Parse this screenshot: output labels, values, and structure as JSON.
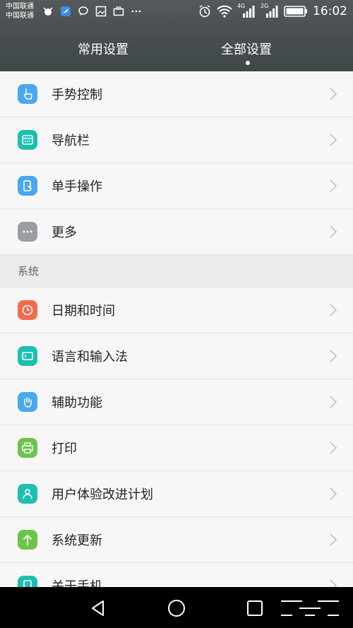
{
  "status_bar": {
    "carrier_1": "中国联通",
    "carrier_2": "中国联通",
    "network_1": "4G",
    "network_2": "2G",
    "time": "16:02"
  },
  "tabs": [
    {
      "label": "常用设置"
    },
    {
      "label": "全部设置"
    }
  ],
  "list": {
    "items_top": [
      {
        "label": "手势控制",
        "icon": "gesture-icon",
        "color": "#4aa8f0"
      },
      {
        "label": "导航栏",
        "icon": "navigation-bar-icon",
        "color": "#1dbfb0"
      },
      {
        "label": "单手操作",
        "icon": "one-hand-icon",
        "color": "#4aa8f0"
      },
      {
        "label": "更多",
        "icon": "more-icon",
        "color": "#9a9da2"
      }
    ],
    "section_title": "系统",
    "items_system": [
      {
        "label": "日期和时间",
        "icon": "clock-icon",
        "color": "#f26b4f"
      },
      {
        "label": "语言和输入法",
        "icon": "keyboard-icon",
        "color": "#1dbfb0"
      },
      {
        "label": "辅助功能",
        "icon": "hand-icon",
        "color": "#4aa8f0"
      },
      {
        "label": "打印",
        "icon": "printer-icon",
        "color": "#6cc54a"
      },
      {
        "label": "用户体验改进计划",
        "icon": "user-icon",
        "color": "#1dbfb0"
      },
      {
        "label": "系统更新",
        "icon": "update-arrow-icon",
        "color": "#6cc54a"
      },
      {
        "label": "关于手机",
        "icon": "phone-icon",
        "color": "#1dbfb0"
      }
    ]
  }
}
